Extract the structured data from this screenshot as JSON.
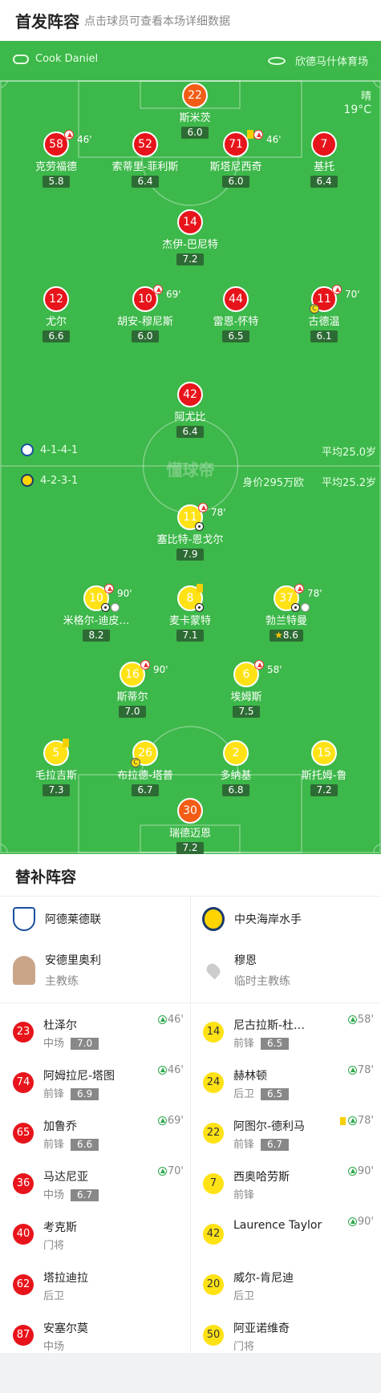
{
  "header": {
    "title": "首发阵容",
    "subtitle": "点击球员可查看本场详细数据"
  },
  "match": {
    "referee": "Cook Daniel",
    "stadium": "欣德马什体育场",
    "weather": "晴",
    "temperature": "19°C",
    "watermark": "懂球帝"
  },
  "home": {
    "formation": "4-1-4-1",
    "avg_age": "平均25.0岁",
    "players": [
      {
        "num": "22",
        "name": "斯米茨",
        "rating": "6.0",
        "kind": "gk"
      },
      {
        "num": "58",
        "name": "克劳福德",
        "rating": "5.8",
        "sub": "46'"
      },
      {
        "num": "52",
        "name": "索蒂里-菲利斯",
        "rating": "6.4"
      },
      {
        "num": "71",
        "name": "斯塔尼西奇",
        "rating": "6.0",
        "sub": "46'",
        "card": true
      },
      {
        "num": "7",
        "name": "基托",
        "rating": "6.4"
      },
      {
        "num": "14",
        "name": "杰伊-巴尼特",
        "rating": "7.2"
      },
      {
        "num": "12",
        "name": "尤尔",
        "rating": "6.6"
      },
      {
        "num": "10",
        "name": "胡安-穆尼斯",
        "rating": "6.0",
        "sub": "69'"
      },
      {
        "num": "44",
        "name": "雷恩-怀特",
        "rating": "6.5"
      },
      {
        "num": "11",
        "name": "古德温",
        "rating": "6.1",
        "sub": "70'",
        "captain": true
      },
      {
        "num": "42",
        "name": "阿尤比",
        "rating": "6.4"
      }
    ]
  },
  "away": {
    "formation": "4-2-3-1",
    "value": "身价295万欧",
    "avg_age": "平均25.2岁",
    "players": [
      {
        "num": "11",
        "name": "塞比特-恩戈尔",
        "rating": "7.9",
        "sub": "78'",
        "goal": true
      },
      {
        "num": "10",
        "name": "米格尔-迪皮…",
        "rating": "8.2",
        "sub": "90'",
        "goal": true,
        "assist": true
      },
      {
        "num": "8",
        "name": "麦卡蒙特",
        "rating": "7.1",
        "card": true,
        "goal": true
      },
      {
        "num": "37",
        "name": "勃兰特曼",
        "rating": "8.6",
        "sub": "78'",
        "goal": true,
        "assist": true,
        "mvp": true
      },
      {
        "num": "16",
        "name": "斯蒂尔",
        "rating": "7.0",
        "sub": "90'"
      },
      {
        "num": "6",
        "name": "埃姆斯",
        "rating": "7.5",
        "sub": "58'"
      },
      {
        "num": "5",
        "name": "毛拉吉斯",
        "rating": "7.3",
        "card": true
      },
      {
        "num": "26",
        "name": "布拉德-塔普",
        "rating": "6.7",
        "captain": true
      },
      {
        "num": "2",
        "name": "多纳基",
        "rating": "6.8"
      },
      {
        "num": "15",
        "name": "斯托姆-鲁",
        "rating": "7.2"
      },
      {
        "num": "30",
        "name": "瑞德迈恩",
        "rating": "7.2",
        "kind": "gk"
      }
    ]
  },
  "subs": {
    "title": "替补阵容",
    "home_team": "阿德莱德联",
    "away_team": "中央海岸水手",
    "home_coach": {
      "name": "安德里奥利",
      "role": "主教练"
    },
    "away_coach": {
      "name": "穆恩",
      "role": "临时主教练"
    },
    "home": [
      {
        "num": "23",
        "name": "杜泽尔",
        "pos": "中场",
        "rating": "7.0",
        "min": "46'"
      },
      {
        "num": "74",
        "name": "阿姆拉尼-塔图",
        "pos": "前锋",
        "rating": "6.9",
        "min": "46'"
      },
      {
        "num": "65",
        "name": "加鲁乔",
        "pos": "前锋",
        "rating": "6.6",
        "min": "69'"
      },
      {
        "num": "36",
        "name": "马达尼亚",
        "pos": "中场",
        "rating": "6.7",
        "min": "70'"
      },
      {
        "num": "40",
        "name": "考克斯",
        "pos": "门将"
      },
      {
        "num": "62",
        "name": "塔拉迪拉",
        "pos": "后卫"
      },
      {
        "num": "87",
        "name": "安塞尔莫",
        "pos": "中场"
      }
    ],
    "away": [
      {
        "num": "14",
        "name": "尼古拉斯-杜…",
        "pos": "前锋",
        "rating": "6.5",
        "min": "58'"
      },
      {
        "num": "24",
        "name": "赫林顿",
        "pos": "后卫",
        "rating": "6.5",
        "min": "78'"
      },
      {
        "num": "22",
        "name": "阿图尔-德利马",
        "pos": "前锋",
        "rating": "6.7",
        "min": "78'",
        "card": true
      },
      {
        "num": "7",
        "name": "西奥哈劳斯",
        "pos": "前锋",
        "min": "90'"
      },
      {
        "num": "42",
        "name": "Laurence Taylor",
        "pos": "",
        "min": "90'"
      },
      {
        "num": "20",
        "name": "威尔-肯尼迪",
        "pos": "后卫"
      },
      {
        "num": "50",
        "name": "阿亚诺维奇",
        "pos": "门将"
      }
    ]
  }
}
